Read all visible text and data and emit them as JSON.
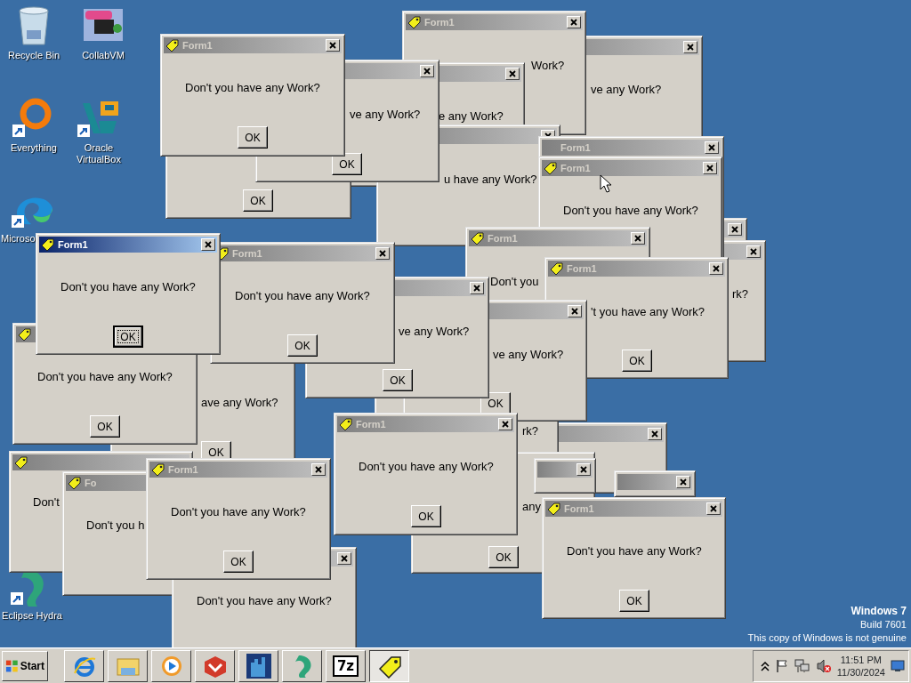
{
  "desktop_icons": [
    {
      "kind": "bin",
      "label": "Recycle Bin"
    },
    {
      "kind": "collabvm",
      "label": "CollabVM"
    },
    {
      "kind": "everything",
      "label": "Everything"
    },
    {
      "kind": "virtualbox",
      "label": "Oracle VirtualBox"
    },
    {
      "kind": "edge",
      "label": "Microso"
    },
    {
      "kind": "hydra",
      "label": "Eclipse Hydra"
    }
  ],
  "windows": [
    {
      "active": false,
      "close": true,
      "message": "ve any Work?"
    },
    {
      "active": false,
      "icon": true,
      "title": "Form1",
      "close": true,
      "message": "Work?"
    },
    {
      "active": false,
      "close": true,
      "message": "e any Work?"
    },
    {
      "active": false,
      "close": true,
      "message": "u have any Work?"
    },
    {
      "ok": {
        "label": "OK",
        "focused": false
      }
    },
    {
      "active": false,
      "close": true,
      "message": "ve any Work?",
      "ok": {
        "label": "OK",
        "focused": false
      }
    },
    {
      "active": false,
      "icon": true,
      "title": "Form1",
      "close": true,
      "message": "Don't you have any Work?",
      "ok": {
        "label": "OK",
        "focused": false
      }
    },
    {
      "active": false,
      "close": true
    },
    {
      "active": false,
      "close": true,
      "message": "rk?"
    },
    {
      "active": false,
      "title": "Form1",
      "close": true
    },
    {
      "active": false,
      "icon": true,
      "title": "Form1",
      "close": true,
      "message": "Don't you have any Work?"
    },
    {
      "active": false,
      "icon": true,
      "title": "Form1",
      "close": true,
      "message": "Don't you"
    },
    {
      "active": false,
      "close": true
    },
    {
      "message": "rk?"
    },
    {
      "active": false,
      "icon": true,
      "title": "Form1",
      "close": true,
      "message": "'t you have any Work?",
      "ok": {
        "label": "OK",
        "focused": false
      }
    },
    {
      "active": false,
      "close": true,
      "message": "ve any Work?",
      "ok": {
        "label": "OK",
        "focused": false
      }
    },
    {
      "active": false,
      "close": true,
      "message": "ve any Work?",
      "ok": {
        "label": "OK",
        "focused": false
      }
    },
    {
      "message": "ave any Work?",
      "ok": {
        "label": "OK",
        "focused": false
      }
    },
    {
      "active": false,
      "icon": true,
      "title": "Form1",
      "close": true,
      "message": "Don't you have any Work?",
      "ok": {
        "label": "OK",
        "focused": false
      }
    },
    {
      "active": true,
      "icon": true,
      "title": "Form1",
      "close": true,
      "message": "Don't you have any Work?",
      "ok": {
        "label": "OK",
        "focused": true
      }
    },
    {
      "active": false,
      "icon": true,
      "message": "Don't you have any Work?",
      "ok": {
        "label": "OK",
        "focused": false
      }
    },
    {
      "active": false,
      "icon": true,
      "message": "Don't"
    },
    {
      "active": false,
      "icon": true,
      "title": "Fo",
      "message": "Don't you h"
    },
    {
      "active": false,
      "icon": true,
      "title": "Form1",
      "close": true,
      "message": "Don't you have any Work?",
      "ok": {
        "label": "OK",
        "focused": false
      }
    },
    {
      "active": false,
      "close": true,
      "message": "Don't you have any Work?"
    },
    {
      "message": "any",
      "ok": {
        "label": "OK",
        "focused": false
      }
    },
    {
      "active": false,
      "close": true
    },
    {
      "active": false,
      "close": true
    },
    {
      "active": false,
      "icon": true,
      "title": "Form1",
      "close": true,
      "message": "Don't you have any Work?",
      "ok": {
        "label": "OK",
        "focused": false
      }
    },
    {
      "active": false,
      "icon": true,
      "title": "Form1",
      "close": true,
      "message": "Don't you have any Work?",
      "ok": {
        "label": "OK",
        "focused": false
      }
    }
  ],
  "genuine_notice": {
    "edition": "Windows 7",
    "build": "Build 7601",
    "warning": "This copy of Windows is not genuine"
  },
  "taskbar": {
    "start": "Start",
    "apps": [
      {
        "kind": "ie",
        "selected": false
      },
      {
        "kind": "explorer",
        "selected": false
      },
      {
        "kind": "media",
        "selected": false
      },
      {
        "kind": "redbox",
        "selected": false
      },
      {
        "kind": "castle",
        "selected": false
      },
      {
        "kind": "hydra",
        "selected": false
      },
      {
        "kind": "sevenzip",
        "label": "7z",
        "selected": false
      },
      {
        "kind": "form",
        "selected": true
      }
    ],
    "tray": {
      "time": "11:51 PM",
      "date": "11/30/2024"
    }
  }
}
